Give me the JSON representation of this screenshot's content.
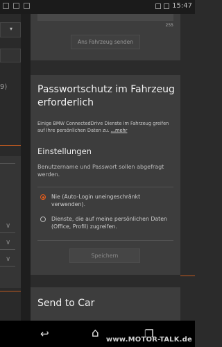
{
  "status_bar": {
    "right_text": "15:47"
  },
  "left_strip": {
    "partial_text": "9)"
  },
  "top_card": {
    "char_counter": "255",
    "send_button": "Ans Fahrzeug senden"
  },
  "main_card": {
    "title": "Passwortschutz im Fahrzeug erforderlich",
    "description": "Einige BMW ConnectedDrive Dienste im Fahrzeug greifen auf Ihre persönlichen Daten zu.",
    "more_link": "...mehr",
    "settings_heading": "Einstellungen",
    "hint": "Benutzername und Passwort sollen abgefragt werden.",
    "options": [
      {
        "label": "Nie (Auto-Login uneingeschränkt verwenden).",
        "selected": true
      },
      {
        "label": "Dienste, die auf meine persönlichen Daten (Office, Profil) zugreifen.",
        "selected": false
      }
    ],
    "save_button": "Speichern"
  },
  "bottom_card": {
    "title": "Send to Car"
  },
  "navbar": {
    "back_icon": "back-icon",
    "home_icon": "home-icon",
    "recents_icon": "recents-icon",
    "watermark": "www.MOTOR-TALK.de"
  },
  "colors": {
    "accent": "#e85d1a",
    "background": "#2b2b2b",
    "card": "#3d3d3d"
  }
}
